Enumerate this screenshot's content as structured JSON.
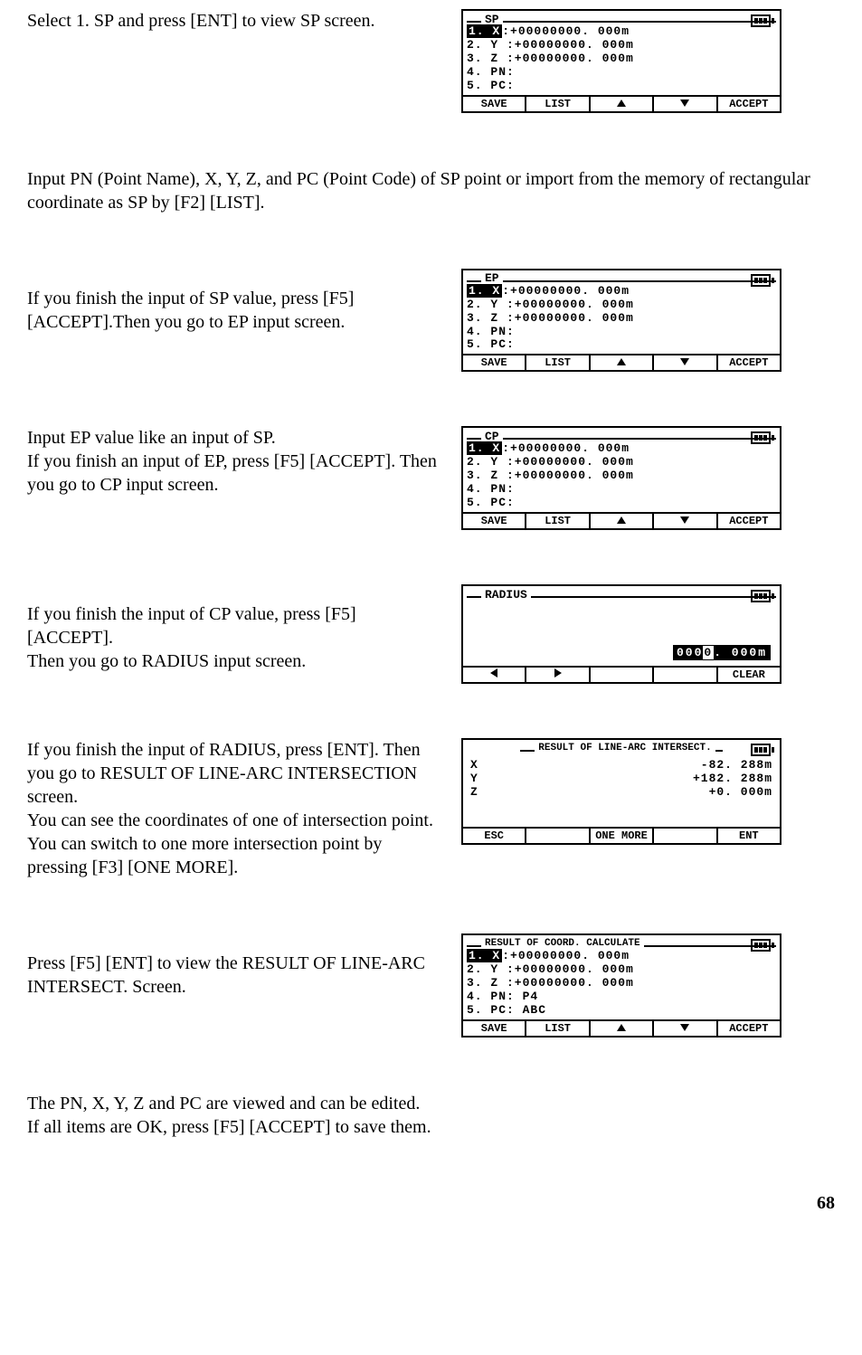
{
  "steps": {
    "s1": {
      "text": "Select 1. SP and press [ENT] to view SP screen.",
      "lcd": {
        "title": "SP",
        "rows": [
          {
            "label": "1. X",
            "hl": true,
            "value": ":+00000000. 000m"
          },
          {
            "label": "2. Y ",
            "hl": false,
            "value": ":+00000000. 000m"
          },
          {
            "label": "3. Z ",
            "hl": false,
            "value": ":+00000000. 000m"
          },
          {
            "label": "4. PN",
            "hl": false,
            "value": ":"
          },
          {
            "label": "5. PC",
            "hl": false,
            "value": ":"
          }
        ],
        "softkeys": [
          "SAVE",
          "LIST",
          "UP",
          "DOWN",
          "ACCEPT"
        ]
      }
    },
    "s2": {
      "text": "Input PN (Point Name), X, Y, Z, and PC (Point Code) of SP point or import from the memory of rectangular coordinate as SP by [F2] [LIST]."
    },
    "s3": {
      "text": "If you finish the input of SP value, press [F5] [ACCEPT].Then you go to EP input screen.",
      "lcd": {
        "title": "EP",
        "rows": [
          {
            "label": "1. X",
            "hl": true,
            "value": ":+00000000. 000m"
          },
          {
            "label": "2. Y ",
            "hl": false,
            "value": ":+00000000. 000m"
          },
          {
            "label": "3. Z ",
            "hl": false,
            "value": ":+00000000. 000m"
          },
          {
            "label": "4. PN",
            "hl": false,
            "value": ":"
          },
          {
            "label": "5. PC",
            "hl": false,
            "value": ":"
          }
        ],
        "softkeys": [
          "SAVE",
          "LIST",
          "UP",
          "DOWN",
          "ACCEPT"
        ]
      }
    },
    "s4": {
      "text": "Input EP value like an input of SP.\nIf you finish an input of EP, press [F5] [ACCEPT]. Then you go to CP input screen.",
      "lcd": {
        "title": "CP",
        "rows": [
          {
            "label": "1. X",
            "hl": true,
            "value": ":+00000000. 000m"
          },
          {
            "label": "2. Y ",
            "hl": false,
            "value": ":+00000000. 000m"
          },
          {
            "label": "3. Z ",
            "hl": false,
            "value": ":+00000000. 000m"
          },
          {
            "label": "4. PN",
            "hl": false,
            "value": ":"
          },
          {
            "label": "5. PC",
            "hl": false,
            "value": ":"
          }
        ],
        "softkeys": [
          "SAVE",
          "LIST",
          "UP",
          "DOWN",
          "ACCEPT"
        ]
      }
    },
    "s5": {
      "text": "If you finish the input of CP value, press [F5] [ACCEPT].\nThen you go to RADIUS input screen.",
      "lcd": {
        "title": "RADIUS",
        "radius_left": "000",
        "radius_cursor": "0",
        "radius_right": ". 000m",
        "softkeys": [
          "LEFT",
          "RIGHT",
          "",
          "",
          "CLEAR"
        ]
      }
    },
    "s6": {
      "text": "If you finish the input of RADIUS, press [ENT]. Then you go to RESULT OF LINE-ARC INTERSECTION screen.\nYou can see the coordinates of one of intersection point. You can switch to one more intersection point by pressing [F3] [ONE MORE].",
      "lcd": {
        "title": "RESULT OF LINE-ARC INTERSECT.",
        "result_rows": [
          {
            "label": "X",
            "value": "-82. 288m"
          },
          {
            "label": "Y",
            "value": "+182. 288m"
          },
          {
            "label": "Z",
            "value": "+0. 000m"
          }
        ],
        "softkeys": [
          "ESC",
          "",
          "ONE MORE",
          "",
          "ENT"
        ]
      }
    },
    "s7": {
      "text": "Press [F5] [ENT] to view the RESULT OF LINE-ARC INTERSECT. Screen.",
      "lcd": {
        "title": "RESULT OF COORD. CALCULATE",
        "rows": [
          {
            "label": "1. X",
            "hl": true,
            "value": ":+00000000. 000m"
          },
          {
            "label": "2. Y ",
            "hl": false,
            "value": ":+00000000. 000m"
          },
          {
            "label": "3. Z ",
            "hl": false,
            "value": ":+00000000. 000m"
          },
          {
            "label": "4. PN",
            "hl": false,
            "value": ": P4"
          },
          {
            "label": "5. PC",
            "hl": false,
            "value": ": ABC"
          }
        ],
        "softkeys": [
          "SAVE",
          "LIST",
          "UP",
          "DOWN",
          "ACCEPT"
        ]
      }
    },
    "s8": {
      "text": "The PN, X, Y, Z and PC are viewed and can be edited.\nIf all items are OK, press [F5] [ACCEPT] to save them."
    }
  },
  "page_number": "68"
}
